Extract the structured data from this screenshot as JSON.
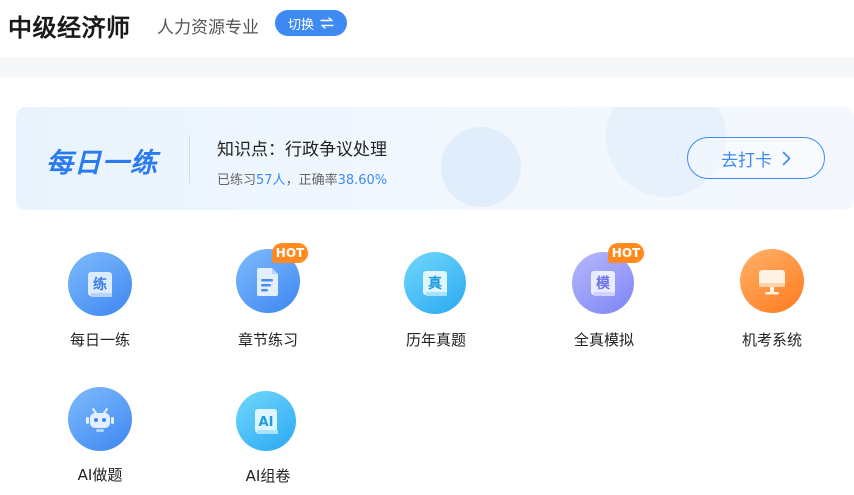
{
  "header": {
    "title": "中级经济师",
    "subject": "人力资源专业",
    "switch_label": "切换"
  },
  "daily_card": {
    "logo_text": "每日一练",
    "knowledge_point": "知识点：行政争议处理",
    "stats_prefix": "已练习",
    "stats_count": "57人",
    "stats_middle": "，正确率",
    "stats_rate": "38.60%",
    "checkin_label": "去打卡"
  },
  "features": [
    {
      "label": "每日一练",
      "icon": "practice-book-icon",
      "glyph": "练",
      "hot": false
    },
    {
      "label": "章节练习",
      "icon": "document-icon",
      "hot": true,
      "hot_label": "HOT"
    },
    {
      "label": "历年真题",
      "icon": "exam-book-icon",
      "glyph": "真",
      "hot": false
    },
    {
      "label": "全真模拟",
      "icon": "mock-book-icon",
      "glyph": "模",
      "hot": true,
      "hot_label": "HOT"
    },
    {
      "label": "机考系统",
      "icon": "computer-icon",
      "hot": false
    },
    {
      "label": "AI做题",
      "icon": "robot-icon",
      "hot": false
    },
    {
      "label": "AI组卷",
      "icon": "ai-paper-icon",
      "glyph": "AI",
      "hot": false
    }
  ],
  "colors": {
    "accent": "#3d8bf2",
    "hot_badge": "#ff8a1f"
  }
}
